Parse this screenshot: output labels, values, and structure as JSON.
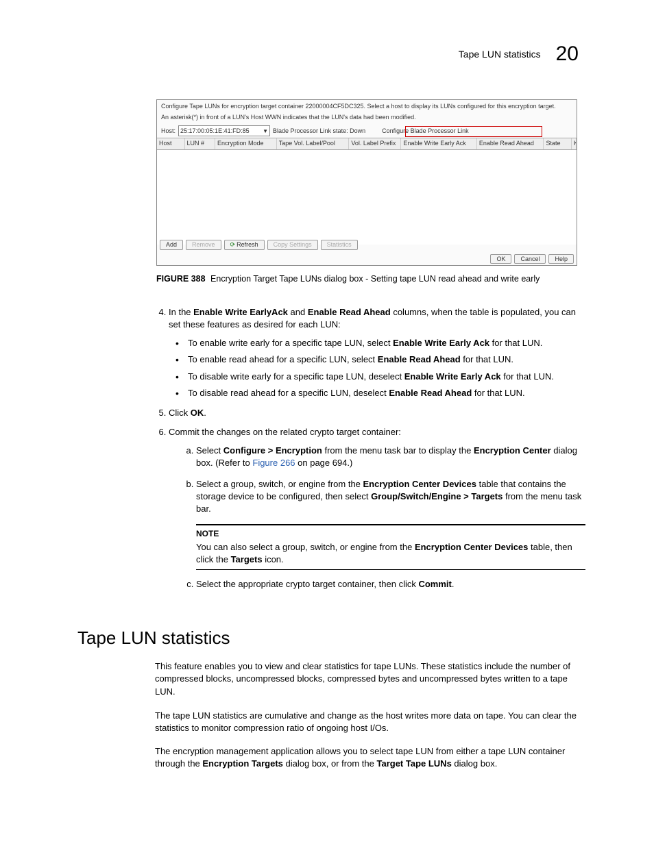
{
  "header": {
    "title": "Tape LUN statistics",
    "chapter": "20"
  },
  "figure": {
    "instr1": "Configure Tape LUNs for encryption target container 22000004CF5DC325. Select a host to display its LUNs configured for this encryption target.",
    "instr2": "An asterisk(*) in front of a LUN's Host WWN indicates that the LUN's data had been modified.",
    "hostlabel": "Host:",
    "hostvalue": "25:17:00:05:1E:41:FD:85",
    "bladeproc": "Blade Processor Link state: Down",
    "configlink": "Configure Blade Processor Link",
    "cols": [
      "Host",
      "LUN #",
      "Encryption Mode",
      "Tape Vol. Label/Pool",
      "Vol. Label Prefix",
      "Enable Write Early Ack",
      "Enable Read Ahead",
      "State",
      "Key Lifespan (days)"
    ],
    "buttons": {
      "add": "Add",
      "remove": "Remove",
      "refresh": "Refresh",
      "copy": "Copy Settings",
      "stats": "Statistics",
      "ok": "OK",
      "cancel": "Cancel",
      "help": "Help"
    }
  },
  "caption": {
    "label": "FIGURE 388",
    "text": "Encryption Target Tape LUNs dialog box - Setting tape LUN read ahead and write early"
  },
  "step4": {
    "pre": "In the ",
    "b1": "Enable Write EarlyAck",
    "mid1": " and ",
    "b2": "Enable Read Ahead",
    "post": " columns, when the table is populated, you can set these features as desired for each LUN:",
    "bullet1": {
      "a": "To enable write early for a specific tape LUN, select ",
      "b": "Enable Write Early Ack",
      "c": " for that LUN."
    },
    "bullet2": {
      "a": "To enable read ahead for a specific LUN, select ",
      "b": "Enable Read Ahead",
      "c": " for that LUN."
    },
    "bullet3": {
      "a": "To disable write early for a specific tape LUN, deselect ",
      "b": "Enable Write Early Ack",
      "c": " for that LUN."
    },
    "bullet4": {
      "a": "To disable read ahead for a specific LUN, deselect ",
      "b": "Enable Read Ahead",
      "c": " for that LUN."
    }
  },
  "step5": {
    "a": "Click ",
    "b": "OK",
    "c": "."
  },
  "step6": {
    "a": "Commit the changes on the related crypto target container:",
    "a1": {
      "t1": "Select ",
      "b1": "Configure > Encryption",
      "t2": " from the menu task bar to display the ",
      "b2": "Encryption Center",
      "t3": " dialog box. (Refer to ",
      "link": "Figure 266",
      "t4": " on page 694.)"
    },
    "b1": {
      "t1": "Select a group, switch, or engine from the ",
      "b1": "Encryption Center Devices",
      "t2": " table that contains the storage device to be configured, then select ",
      "b2": "Group/Switch/Engine > Targets",
      "t3": " from the menu task bar."
    },
    "notehead": "NOTE",
    "note": {
      "t1": "You can also select a group, switch, or engine from the ",
      "b1": "Encryption Center Devices",
      "t2": " table, then click the ",
      "b2": "Targets",
      "t3": " icon."
    },
    "c1": {
      "t1": "Select the appropriate crypto target container, then click ",
      "b1": "Commit",
      "t2": "."
    }
  },
  "section": "Tape LUN statistics",
  "p1": "This feature enables you to view and clear statistics for tape LUNs. These statistics include the number of compressed blocks, uncompressed blocks, compressed bytes and uncompressed bytes written to a tape LUN.",
  "p2": "The tape LUN statistics are cumulative and change as the host writes more data on tape. You can clear the statistics to monitor compression ratio of ongoing host I/Os.",
  "p3": {
    "t1": "The encryption management application allows you to select tape LUN from either a tape LUN container through the ",
    "b1": "Encryption Targets",
    "t2": " dialog box, or from the ",
    "b2": "Target Tape LUNs",
    "t3": " dialog box."
  }
}
